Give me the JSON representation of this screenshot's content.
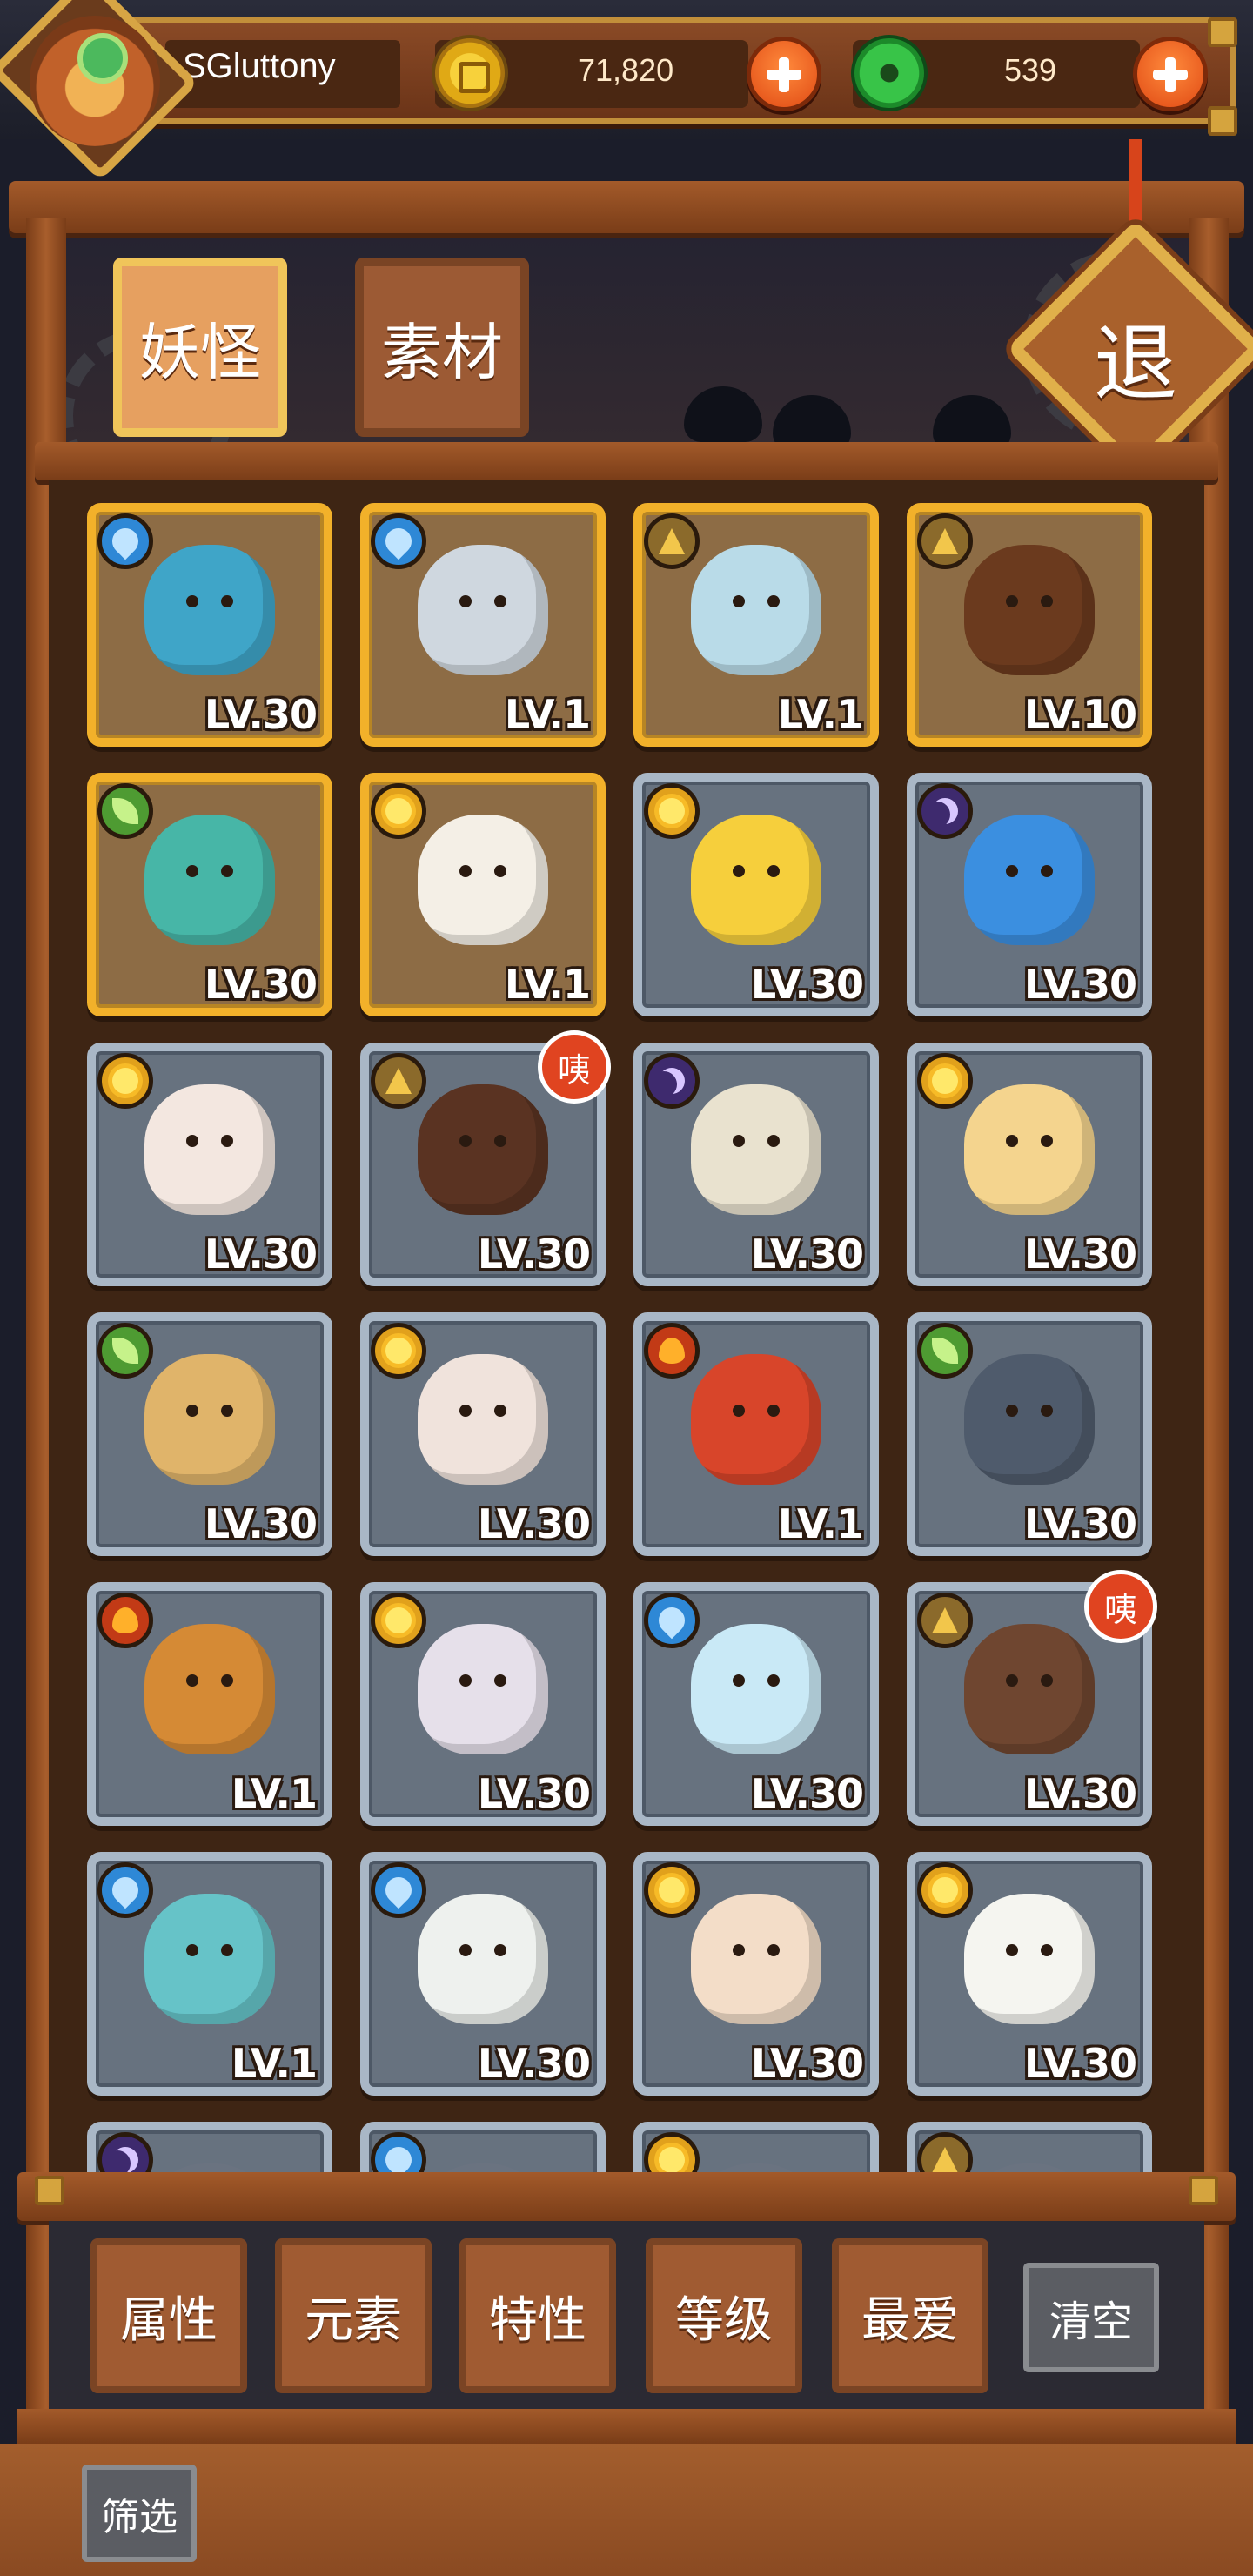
{
  "header": {
    "username": "SGluttony",
    "coins": "71,820",
    "jade": "539",
    "coin_icon": "gold-coin-icon",
    "jade_icon": "green-jade-icon"
  },
  "tabs": [
    {
      "label": "妖怪",
      "active": true
    },
    {
      "label": "素材",
      "active": false
    }
  ],
  "exit_label": "退",
  "cards": [
    {
      "element": "water",
      "level": "LV.30",
      "frame": "gold",
      "color": "#3fa5c8"
    },
    {
      "element": "water",
      "level": "LV.1",
      "frame": "gold",
      "color": "#cfd7df"
    },
    {
      "element": "earth",
      "level": "LV.1",
      "frame": "gold",
      "color": "#b9dbe8"
    },
    {
      "element": "earth",
      "level": "LV.10",
      "frame": "gold",
      "color": "#6b3a1e"
    },
    {
      "element": "wood",
      "level": "LV.30",
      "frame": "gold",
      "color": "#47b6a7"
    },
    {
      "element": "light",
      "level": "LV.1",
      "frame": "gold",
      "color": "#f4efe6"
    },
    {
      "element": "light",
      "level": "LV.30",
      "frame": "steel",
      "color": "#f6cf3c"
    },
    {
      "element": "dark",
      "level": "LV.30",
      "frame": "steel",
      "color": "#3b8fe0"
    },
    {
      "element": "light",
      "level": "LV.30",
      "frame": "steel",
      "color": "#f3e7e0"
    },
    {
      "element": "earth",
      "level": "LV.30",
      "frame": "steel",
      "color": "#5a3322",
      "tag": "咦"
    },
    {
      "element": "dark",
      "level": "LV.30",
      "frame": "steel",
      "color": "#e9e2cf"
    },
    {
      "element": "light",
      "level": "LV.30",
      "frame": "steel",
      "color": "#f4d48e"
    },
    {
      "element": "wood",
      "level": "LV.30",
      "frame": "steel",
      "color": "#e0b46a"
    },
    {
      "element": "light",
      "level": "LV.30",
      "frame": "steel",
      "color": "#f0e3dc"
    },
    {
      "element": "fire",
      "level": "LV.1",
      "frame": "steel",
      "color": "#d8452a"
    },
    {
      "element": "wood",
      "level": "LV.30",
      "frame": "steel",
      "color": "#4f5b6c"
    },
    {
      "element": "fire",
      "level": "LV.1",
      "frame": "steel",
      "color": "#d58a35"
    },
    {
      "element": "light",
      "level": "LV.30",
      "frame": "steel",
      "color": "#e6e0ea"
    },
    {
      "element": "water",
      "level": "LV.30",
      "frame": "steel",
      "color": "#c9e9f6"
    },
    {
      "element": "earth",
      "level": "LV.30",
      "frame": "steel",
      "color": "#6f4630",
      "tag": "咦"
    },
    {
      "element": "water",
      "level": "LV.1",
      "frame": "steel",
      "color": "#66c3c8"
    },
    {
      "element": "water",
      "level": "LV.30",
      "frame": "steel",
      "color": "#eef1ee"
    },
    {
      "element": "light",
      "level": "LV.30",
      "frame": "steel",
      "color": "#f3ddc8"
    },
    {
      "element": "light",
      "level": "LV.30",
      "frame": "steel",
      "color": "#f5f5f0"
    },
    {
      "element": "dark",
      "level": "",
      "frame": "steel",
      "color": "#6a7380"
    },
    {
      "element": "water",
      "level": "",
      "frame": "steel",
      "color": "#6a7380"
    },
    {
      "element": "light",
      "level": "",
      "frame": "steel",
      "color": "#6a7380"
    },
    {
      "element": "earth",
      "level": "",
      "frame": "steel",
      "color": "#6a7380"
    }
  ],
  "filters": {
    "buttons": [
      "属性",
      "元素",
      "特性",
      "等级",
      "最爱"
    ],
    "clear_label": "清空",
    "screen_label": "筛选"
  }
}
